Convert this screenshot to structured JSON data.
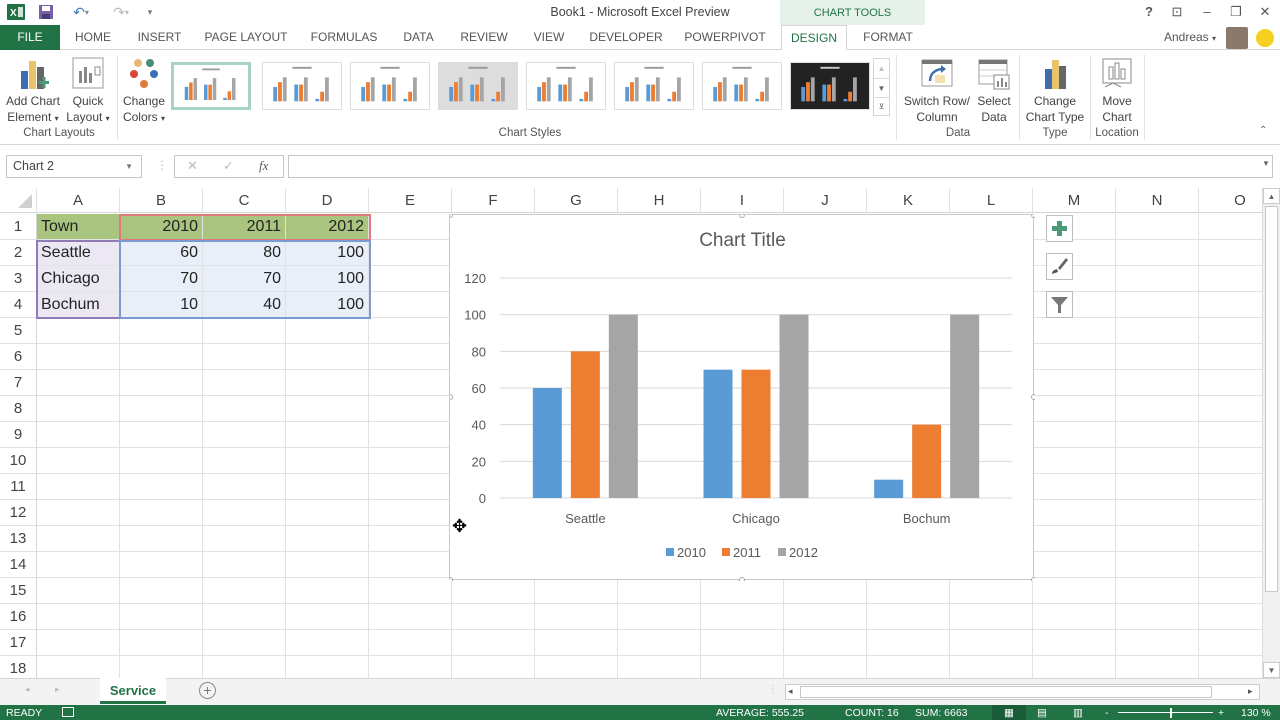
{
  "window": {
    "title": "Book1 - Microsoft Excel Preview",
    "context_tab_group": "CHART TOOLS",
    "user": "Andreas",
    "controls": [
      "help-icon",
      "ribbon-display-icon",
      "minimize-icon",
      "restore-icon",
      "close-icon"
    ]
  },
  "quick_access": [
    "excel-logo-icon",
    "save-icon",
    "undo-icon",
    "redo-icon",
    "customize-icon"
  ],
  "tabs": [
    {
      "label": "FILE"
    },
    {
      "label": "HOME"
    },
    {
      "label": "INSERT"
    },
    {
      "label": "PAGE LAYOUT"
    },
    {
      "label": "FORMULAS"
    },
    {
      "label": "DATA"
    },
    {
      "label": "REVIEW"
    },
    {
      "label": "VIEW"
    },
    {
      "label": "DEVELOPER"
    },
    {
      "label": "POWERPIVOT"
    },
    {
      "label": "DESIGN",
      "active": true
    },
    {
      "label": "FORMAT"
    }
  ],
  "ribbon": {
    "add_chart_element": {
      "line1": "Add Chart",
      "line2": "Element"
    },
    "quick_layout": {
      "line1": "Quick",
      "line2": "Layout"
    },
    "change_colors": {
      "line1": "Change",
      "line2": "Colors"
    },
    "chart_layouts_label": "Chart Layouts",
    "chart_styles_label": "Chart Styles",
    "switch_row_col": {
      "line1": "Switch Row/",
      "line2": "Column"
    },
    "select_data": {
      "line1": "Select",
      "line2": "Data"
    },
    "data_label": "Data",
    "change_chart_type": {
      "line1": "Change",
      "line2": "Chart Type"
    },
    "type_label": "Type",
    "move_chart": {
      "line1": "Move",
      "line2": "Chart"
    },
    "location_label": "Location",
    "styles_count": 8
  },
  "formula_bar": {
    "name_box": "Chart 2",
    "formula": "",
    "cancel": "✕",
    "enter": "✓",
    "fx": "fx"
  },
  "columns": [
    "A",
    "B",
    "C",
    "D",
    "E",
    "F",
    "G",
    "H",
    "I",
    "J",
    "K",
    "L",
    "M",
    "N",
    "O"
  ],
  "rows": [
    "1",
    "2",
    "3",
    "4",
    "5",
    "6",
    "7",
    "8",
    "9",
    "10",
    "11",
    "12",
    "13",
    "14",
    "15",
    "16",
    "17",
    "18"
  ],
  "table": {
    "header": [
      "Town",
      "2010",
      "2011",
      "2012"
    ],
    "rows": [
      [
        "Seattle",
        "60",
        "80",
        "100"
      ],
      [
        "Chicago",
        "70",
        "70",
        "100"
      ],
      [
        "Bochum",
        "10",
        "40",
        "100"
      ]
    ]
  },
  "chart_data": {
    "type": "bar",
    "title": "Chart Title",
    "categories": [
      "Seattle",
      "Chicago",
      "Bochum"
    ],
    "series": [
      {
        "name": "2010",
        "values": [
          60,
          70,
          10
        ],
        "color": "#5b9bd5"
      },
      {
        "name": "2011",
        "values": [
          80,
          70,
          40
        ],
        "color": "#ed7d31"
      },
      {
        "name": "2012",
        "values": [
          100,
          100,
          100
        ],
        "color": "#a5a5a5"
      }
    ],
    "xlabel": "",
    "ylabel": "",
    "ylim": [
      0,
      120
    ],
    "yticks": [
      "0",
      "20",
      "40",
      "60",
      "80",
      "100",
      "120"
    ],
    "grid": true,
    "legend": "bottom"
  },
  "chart_side_buttons": [
    "chart-elements-plus-icon",
    "chart-styles-brush-icon",
    "chart-filters-funnel-icon"
  ],
  "sheets": [
    {
      "name": "Service",
      "active": true
    }
  ],
  "status": {
    "mode": "READY",
    "average": "AVERAGE: 555.25",
    "count": "COUNT: 16",
    "sum": "SUM: 6663",
    "zoom": "130 %"
  },
  "colors": {
    "accent": "#217346",
    "series2010": "#5b9bd5",
    "series2011": "#ed7d31",
    "series2012": "#a5a5a5"
  }
}
